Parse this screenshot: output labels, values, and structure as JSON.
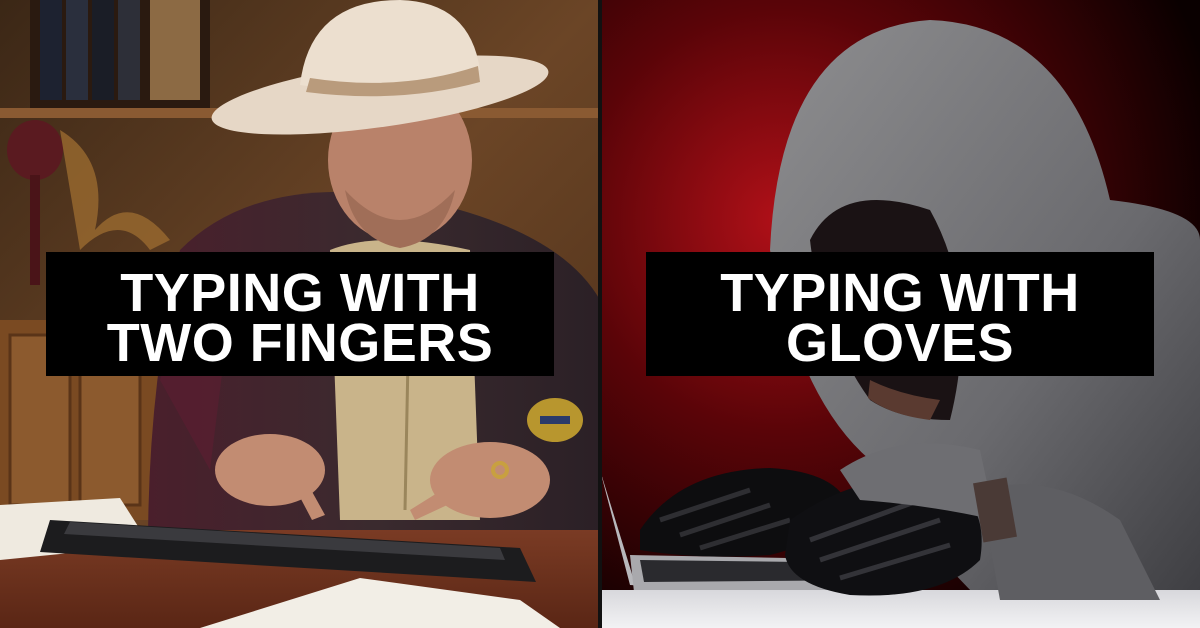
{
  "left_panel": {
    "caption_line1": "TYPING WITH",
    "caption_line2": "TWO FINGERS"
  },
  "right_panel": {
    "caption_line1": "TYPING WITH",
    "caption_line2": "GLOVES"
  },
  "colors": {
    "left_background": "#5a3a22",
    "right_background": "#6a0508",
    "caption_box": "#000000",
    "caption_text": "#ffffff"
  }
}
